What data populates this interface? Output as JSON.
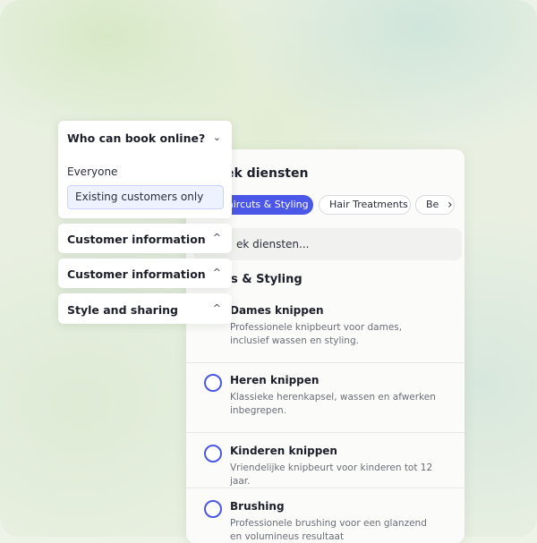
{
  "services_panel": {
    "title": "ek diensten",
    "tabs": [
      {
        "label": "aircuts & Styling",
        "active": true
      },
      {
        "label": "Hair Treatments",
        "active": false
      },
      {
        "label": "Be",
        "active": false
      }
    ],
    "search_placeholder": "ek diensten...",
    "section_title": "s & Styling",
    "services": [
      {
        "name": "Dames knippen",
        "description": "Professionele knipbeurt voor dames, inclusief wassen en styling.",
        "selected": false
      },
      {
        "name": "Heren knippen",
        "description": "Klassieke herenkapsel, wassen en afwerken inbegrepen.",
        "selected": false
      },
      {
        "name": "Kinderen knippen",
        "description": "Vriendelijke knipbeurt voor kinderen tot 12 jaar.",
        "selected": false
      },
      {
        "name": "Brushing",
        "description": "Professionele brushing voor een glanzend en volumineus resultaat",
        "selected": false
      }
    ]
  },
  "settings": {
    "booking": {
      "title": "Who can book online?",
      "options": [
        "Everyone",
        "Existing customers only"
      ],
      "selected": "Existing customers only"
    },
    "sections": [
      {
        "title": "Customer information"
      },
      {
        "title": "Customer information"
      },
      {
        "title": "Style and sharing"
      }
    ]
  },
  "colors": {
    "accent": "#4b57e6",
    "selected_bg": "#eef2ff"
  }
}
